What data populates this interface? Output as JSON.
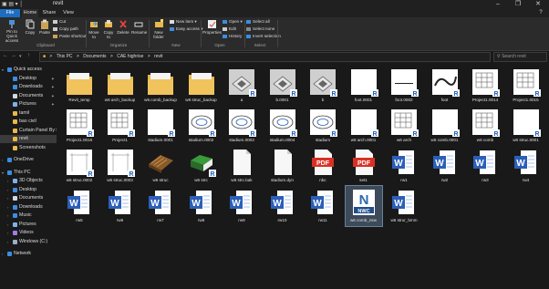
{
  "window": {
    "title": "revit",
    "controls": [
      "–",
      "❐",
      "✕"
    ]
  },
  "tabs": [
    {
      "label": "File"
    },
    {
      "label": "Home"
    },
    {
      "label": "Share"
    },
    {
      "label": "View"
    }
  ],
  "ribbon": {
    "clipboard": {
      "pin_label": "Pin to Quick access",
      "copy_label": "Copy",
      "paste_label": "Paste",
      "cut_label": "Cut",
      "copy_path_label": "Copy path",
      "paste_shortcut_label": "Paste shortcut",
      "group_label": "Clipboard"
    },
    "organize": {
      "move_to_label": "Move to",
      "copy_to_label": "Copy to",
      "delete_label": "Delete",
      "rename_label": "Rename",
      "group_label": "Organize"
    },
    "new": {
      "new_folder_label": "New folder",
      "new_item_label": "New item",
      "easy_access_label": "Easy access",
      "group_label": "New"
    },
    "open": {
      "properties_label": "Properties",
      "open_label": "Open",
      "edit_label": "Edit",
      "history_label": "History",
      "group_label": "Open"
    },
    "select": {
      "select_all_label": "Select all",
      "select_none_label": "Select none",
      "invert_label": "Invert selection",
      "group_label": "Select"
    }
  },
  "address": {
    "segments": [
      "This PC",
      "Documents",
      "CAE highrise",
      "revit"
    ],
    "separator": ">",
    "search_placeholder": "Search revit"
  },
  "nav_pane": [
    {
      "label": "Quick access",
      "icon": "star-icon",
      "color": "#3c8de0",
      "level": 0,
      "expander": "v"
    },
    {
      "label": "Desktop",
      "icon": "desktop-icon",
      "color": "#3c8de0",
      "level": 1,
      "pinned": true
    },
    {
      "label": "Downloads",
      "icon": "download-icon",
      "color": "#3c8de0",
      "level": 1,
      "pinned": true
    },
    {
      "label": "Documents",
      "icon": "documents-icon",
      "color": "#cfd8e3",
      "level": 1,
      "pinned": true
    },
    {
      "label": "Pictures",
      "icon": "pictures-icon",
      "color": "#7fb2e6",
      "level": 1,
      "pinned": true
    },
    {
      "label": "tamil",
      "icon": "folder-icon",
      "color": "#e8b84a",
      "level": 1
    },
    {
      "label": "bao civil",
      "icon": "folder-icon",
      "color": "#e8b84a",
      "level": 1
    },
    {
      "label": "Curtain Panel By Pat",
      "icon": "folder-icon",
      "color": "#e8b84a",
      "level": 1
    },
    {
      "label": "revit",
      "icon": "folder-icon",
      "color": "#e8b84a",
      "level": 1,
      "selected": true
    },
    {
      "label": "Screenshots",
      "icon": "folder-icon",
      "color": "#e8b84a",
      "level": 1
    },
    {
      "label": "",
      "icon": "",
      "color": "",
      "level": 0,
      "spacer": true
    },
    {
      "label": "OneDrive",
      "icon": "cloud-icon",
      "color": "#3c8de0",
      "level": 0,
      "expander": ">"
    },
    {
      "label": "",
      "icon": "",
      "color": "",
      "level": 0,
      "spacer": true
    },
    {
      "label": "This PC",
      "icon": "pc-icon",
      "color": "#3c8de0",
      "level": 0,
      "expander": "v"
    },
    {
      "label": "3D Objects",
      "icon": "cube-icon",
      "color": "#7fb2e6",
      "level": 1,
      "expander": ">"
    },
    {
      "label": "Desktop",
      "icon": "desktop-icon",
      "color": "#3c8de0",
      "level": 1,
      "expander": ">"
    },
    {
      "label": "Documents",
      "icon": "documents-icon",
      "color": "#cfd8e3",
      "level": 1,
      "expander": ">"
    },
    {
      "label": "Downloads",
      "icon": "download-icon",
      "color": "#3c8de0",
      "level": 1,
      "expander": ">"
    },
    {
      "label": "Music",
      "icon": "music-icon",
      "color": "#3c8de0",
      "level": 1,
      "expander": ">"
    },
    {
      "label": "Pictures",
      "icon": "pictures-icon",
      "color": "#7fb2e6",
      "level": 1,
      "expander": ">"
    },
    {
      "label": "Videos",
      "icon": "videos-icon",
      "color": "#9a7fe6",
      "level": 1,
      "expander": ">"
    },
    {
      "label": "Windows (C:)",
      "icon": "drive-icon",
      "color": "#9ab0c6",
      "level": 1,
      "expander": ">"
    },
    {
      "label": "",
      "icon": "",
      "color": "",
      "level": 0,
      "spacer": true
    },
    {
      "label": "Network",
      "icon": "network-icon",
      "color": "#3c8de0",
      "level": 0,
      "expander": ">"
    }
  ],
  "files": [
    {
      "name": "Revit_temp",
      "kind": "folder"
    },
    {
      "name": "w6 arch_backup",
      "kind": "folder"
    },
    {
      "name": "w6.comb_backup",
      "kind": "folder"
    },
    {
      "name": "w6 struc_backup",
      "kind": "folder"
    },
    {
      "name": "a",
      "kind": "rvt-3d"
    },
    {
      "name": "b.0001",
      "kind": "rvt-3d"
    },
    {
      "name": "b",
      "kind": "rvt-3d"
    },
    {
      "name": "foot.0001",
      "kind": "rvt-white"
    },
    {
      "name": "foot.0002",
      "kind": "rvt-line"
    },
    {
      "name": "foot",
      "kind": "rvt-curve"
    },
    {
      "name": "Project1.0014",
      "kind": "rvt-plan"
    },
    {
      "name": "Project1.0015",
      "kind": "rvt-plan"
    },
    {
      "name": "Project1.0016",
      "kind": "rvt-plan"
    },
    {
      "name": "Project1",
      "kind": "rvt-plan"
    },
    {
      "name": "stadium.0001",
      "kind": "rvt-white"
    },
    {
      "name": "stadium.0002",
      "kind": "rvt-oval"
    },
    {
      "name": "stadium.0003",
      "kind": "rvt-oval"
    },
    {
      "name": "stadium.0004",
      "kind": "rvt-oval"
    },
    {
      "name": "stadium",
      "kind": "rvt-oval"
    },
    {
      "name": "w6 arch.0001",
      "kind": "rvt-white"
    },
    {
      "name": "w6 arch",
      "kind": "rvt-plan"
    },
    {
      "name": "w6 comb.0001",
      "kind": "rvt-white"
    },
    {
      "name": "w6 comb",
      "kind": "rvt-plan"
    },
    {
      "name": "w6 struc.0001",
      "kind": "rvt-white"
    },
    {
      "name": "w6 struc.0002",
      "kind": "rvt-grid"
    },
    {
      "name": "w6 struc.0003",
      "kind": "rvt-grid"
    },
    {
      "name": "w6 struc",
      "kind": "rvt-wood"
    },
    {
      "name": "w6 strc",
      "kind": "rvt-green"
    },
    {
      "name": "w6 strc.bak",
      "kind": "blank"
    },
    {
      "name": "stadium.dyn",
      "kind": "blank"
    },
    {
      "name": "nbc",
      "kind": "pdf"
    },
    {
      "name": "set1",
      "kind": "pdf"
    },
    {
      "name": "rw1",
      "kind": "word"
    },
    {
      "name": "rw2",
      "kind": "word"
    },
    {
      "name": "rw3",
      "kind": "word"
    },
    {
      "name": "rw4",
      "kind": "word"
    },
    {
      "name": "rw5",
      "kind": "word"
    },
    {
      "name": "rw6",
      "kind": "word"
    },
    {
      "name": "rw7",
      "kind": "word"
    },
    {
      "name": "rw8",
      "kind": "word"
    },
    {
      "name": "rw9",
      "kind": "word"
    },
    {
      "name": "rw10",
      "kind": "word"
    },
    {
      "name": "rw11",
      "kind": "word"
    },
    {
      "name": "w6 comb_nsw",
      "kind": "nwc",
      "selected": true
    },
    {
      "name": "w6 strur_bmm",
      "kind": "word"
    }
  ],
  "badges": {
    "rvt": "R",
    "pdf": "PDF",
    "word": "W",
    "nwc": "N",
    "nwc_tag": "NWC"
  },
  "colors": {
    "folder": "#e8b84a",
    "revit_badge": "#1f5fbf",
    "pdf": "#d93025",
    "word": "#2b5fb8",
    "selection": "#3d4a5a"
  }
}
